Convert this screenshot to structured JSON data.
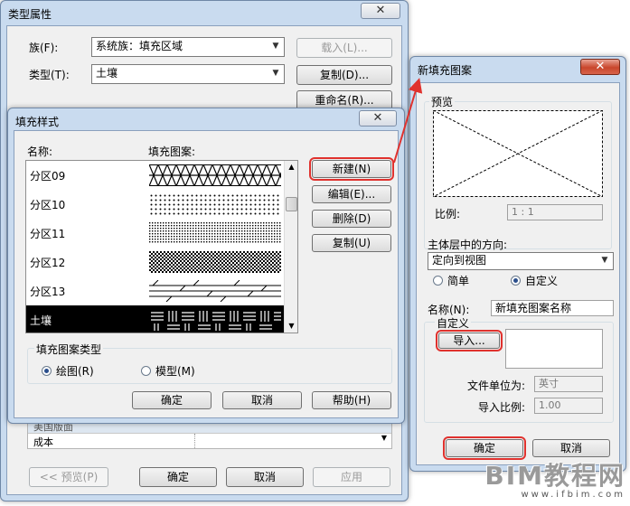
{
  "type_properties": {
    "title": "类型属性",
    "family_label": "族(F):",
    "family_value": "系统族：填充区域",
    "type_label": "类型(T):",
    "type_value": "土壤",
    "load_label": "载入(L)...",
    "duplicate_label": "复制(D)...",
    "rename_label": "重命名(R)...",
    "row_partial": "美国版面",
    "row_cost": "成本",
    "preview_label": "<< 预览(P)",
    "ok_label": "确定",
    "cancel_label": "取消",
    "apply_label": "应用"
  },
  "fill_patterns": {
    "title": "填充样式",
    "col_name": "名称:",
    "col_pattern": "填充图案:",
    "items": [
      {
        "name": "分区09"
      },
      {
        "name": "分区10"
      },
      {
        "name": "分区11"
      },
      {
        "name": "分区12"
      },
      {
        "name": "分区13"
      },
      {
        "name": "土壤"
      }
    ],
    "new_label": "新建(N)",
    "edit_label": "编辑(E)...",
    "delete_label": "删除(D)",
    "copy_label": "复制(U)",
    "type_group_label": "填充图案类型",
    "drafting_label": "绘图(R)",
    "model_label": "模型(M)",
    "ok_label": "确定",
    "cancel_label": "取消",
    "help_label": "帮助(H)"
  },
  "new_pattern": {
    "title": "新填充图案",
    "preview_label": "预览",
    "scale_label": "比例:",
    "scale_value": "1 : 1",
    "orientation_label": "主体层中的方向:",
    "orientation_value": "定向到视图",
    "simple_label": "简单",
    "custom_label": "自定义",
    "name_label": "名称(N):",
    "name_value": "新填充图案名称",
    "custom_group_label": "自定义",
    "import_label": "导入...",
    "file_units_label": "文件单位为:",
    "file_units_value": "英寸",
    "import_scale_label": "导入比例:",
    "import_scale_value": "1.00",
    "ok_label": "确定",
    "cancel_label": "取消"
  },
  "watermark": {
    "brand": "BIM教程网",
    "url": "www.ifbim.com"
  },
  "colors": {
    "highlight": "#e0322e",
    "selection": "#000000",
    "title_bar": "#c9dbef"
  }
}
